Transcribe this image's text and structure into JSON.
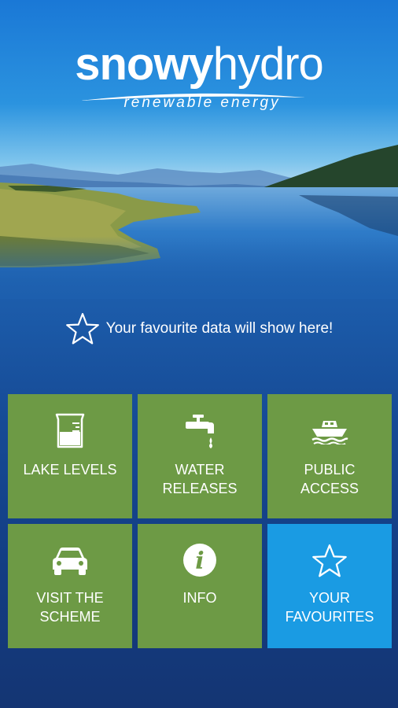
{
  "logo": {
    "brand_part1": "snowy",
    "brand_part2": "hydro",
    "tagline": "renewable energy"
  },
  "favourites_notice": {
    "icon": "star-outline-icon",
    "text": "Your favourite data will show here!"
  },
  "tiles": [
    {
      "id": "lake-levels",
      "label": "LAKE LEVELS",
      "icon": "beaker-icon",
      "color": "#6d9a45"
    },
    {
      "id": "water-releases",
      "label": "WATER\nRELEASES",
      "icon": "tap-icon",
      "color": "#6d9a45"
    },
    {
      "id": "public-access",
      "label": "PUBLIC\nACCESS",
      "icon": "boat-icon",
      "color": "#6d9a45"
    },
    {
      "id": "visit-scheme",
      "label": "VISIT THE\nSCHEME",
      "icon": "car-icon",
      "color": "#6d9a45"
    },
    {
      "id": "info",
      "label": "INFO",
      "icon": "info-icon",
      "color": "#6d9a45"
    },
    {
      "id": "your-favourites",
      "label": "YOUR\nFAVOURITES",
      "icon": "star-outline-icon",
      "color": "#1a9be3"
    }
  ],
  "colors": {
    "tile_green": "#6d9a45",
    "tile_blue": "#1a9be3",
    "background_top": "#1c7ed8",
    "background_bottom": "#143573"
  }
}
